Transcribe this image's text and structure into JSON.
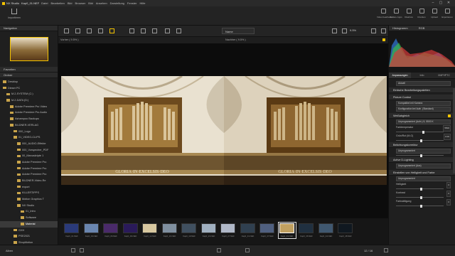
{
  "app": {
    "title": "NX Studio",
    "file": "Kap0_01.NEF",
    "menu": [
      "Datei",
      "Bearbeiten",
      "Bild",
      "Browser",
      "Bild",
      "Ansehen",
      "Darstellung",
      "Fenster",
      "Hilfe"
    ],
    "window_controls": [
      "–",
      "▢",
      "✕"
    ]
  },
  "toolbar": {
    "import_label": "Importieren",
    "right_tools": [
      "Video bearbeiten",
      "Andere Apps",
      "Diashow",
      "Drucken",
      "Upload",
      "Exportieren"
    ]
  },
  "left_panel": {
    "navigation_title": "Navigation",
    "favorites_title": "Favoriten",
    "folders_title": "Ordner",
    "albums_title": "Alben",
    "tree": [
      {
        "label": "Desktop",
        "level": 0
      },
      {
        "label": "Dieser PC",
        "level": 0
      },
      {
        "label": "M.2-SYSTEM (C:)",
        "level": 1
      },
      {
        "label": "M.2-DATA (D:)",
        "level": 1
      },
      {
        "label": "Adobe Premiere Pro Video",
        "level": 2
      },
      {
        "label": "Adobe Premiere Pro Audio",
        "level": 2
      },
      {
        "label": "Ashampoo Backups",
        "level": 2
      },
      {
        "label": "BILDNER-VERLAG",
        "level": 2
      },
      {
        "label": "000_Logo",
        "level": 3
      },
      {
        "label": "01_VIDEO-CLIPS",
        "level": 3
      },
      {
        "label": "000_AUDIO-Effekte",
        "level": 4
      },
      {
        "label": "000_Vorspecher_PDF",
        "level": 4
      },
      {
        "label": "00_Manuskripte 1",
        "level": 4
      },
      {
        "label": "Adobe Premiere Pro",
        "level": 4
      },
      {
        "label": "Adobe Premiere Pro",
        "level": 4
      },
      {
        "label": "Adobe Premiere Pro",
        "level": 4
      },
      {
        "label": "BILDNER-Video-Re",
        "level": 4
      },
      {
        "label": "export",
        "level": 4
      },
      {
        "label": "KILLERTIPPS",
        "level": 4
      },
      {
        "label": "Motion Graphics T",
        "level": 4
      },
      {
        "label": "NX Studio",
        "level": 4
      },
      {
        "label": "01_Intro",
        "level": 5
      },
      {
        "label": "Software",
        "level": 5
      },
      {
        "label": "Material",
        "level": 5,
        "selected": true
      },
      {
        "label": "GXH",
        "level": 3
      },
      {
        "label": "PSE2021",
        "level": 3
      },
      {
        "label": "ShopMotion",
        "level": 3
      }
    ]
  },
  "viewer": {
    "sort_label": "Name",
    "zoom_text": "9.5%",
    "left_label": "Vorher ( 9.5% )",
    "right_label": "Nachher ( 9.5% )",
    "inscription": "GLORIA·IN·EXCELSIS·DEO"
  },
  "filmstrip": [
    "Kap0_01.NEF",
    "Kap0_03.NEF",
    "Kap0_06.NEF",
    "Kap0_09.NEF",
    "Kap0_12.NEF",
    "Kap0_16.NEF",
    "Kap0_19.NEF",
    "Kap0_23.NEF",
    "Kap0_27.NEF",
    "Kap0_31.NEF",
    "Kap0_37.NEF",
    "Kap0_01.NEF",
    "Kap0_36.NEF",
    "Kap0_44.NEF",
    "Kap0_48.NEF"
  ],
  "filmstrip_selected": 11,
  "counter": "12 / 16",
  "right_panel": {
    "histogram_mode": "RGB",
    "tabs": [
      "Anpassungen",
      "Info",
      "XMP/IPTC"
    ],
    "preset": "Aktuell",
    "basic_title": "Einfache Bearbeitungspaletten",
    "picture_control_title": "Picture Control",
    "picture_control_value": "Kompatibel mit Kamera",
    "picture_control_sub": "Konfiguration bei Aufn. (Standard)",
    "wb_title": "Weißabgleich",
    "wb_value": "Unprogrammiert (Aufn.) 5, 5500 K",
    "wb_temp_label": "Farbtemperatur",
    "wb_temp_value": "5500",
    "wb_tint_label": "Grün/Rot (M-G)",
    "wb_tint_value": "0.00",
    "exposure_title": "Belichtungskorrektur",
    "exposure_value": "0.00",
    "exposure_unit": "Unprogrammiert",
    "adl_title": "Active D-Lighting",
    "adl_value": "Unprogrammiert (Aus)",
    "levels_title": "Einstellen von Helligkeit und Farbe",
    "levels_value": "Unprogrammiert",
    "sliders": [
      {
        "label": "Helligkeit",
        "value": "0"
      },
      {
        "label": "Kontrast",
        "value": "0"
      },
      {
        "label": "Farbsättigung",
        "value": "0"
      }
    ]
  },
  "colors": {
    "accent": "#f5c400",
    "background": "#1b1b1b"
  }
}
